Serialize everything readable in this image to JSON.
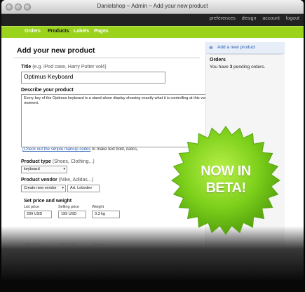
{
  "window": {
    "title": "Danielshop ~ Admin ~ Add your new product"
  },
  "toplinks": [
    "preferences",
    "design",
    "account",
    "logout"
  ],
  "nav": {
    "items": [
      "Orders",
      "Products",
      "Labels",
      "Pages"
    ],
    "active": "Products"
  },
  "page": {
    "heading": "Add your new product"
  },
  "form": {
    "title_label": "Title",
    "title_hint": "(e.g. iPod case, Harry Potter vol4)",
    "title_value": "Optimus Keyboard",
    "desc_label": "Describe your product",
    "desc_value": "Every key of the Optimus keyboard is a stand-alone display showing exactly what it is controlling at this very moment.",
    "markup_link": "(Check out the simple markup codes",
    "markup_rest": "to make text bold, italics,",
    "type_label": "Product type",
    "type_hint": "(Shoes, Clothing...)",
    "type_value": "keyboard",
    "vendor_label": "Product vendor",
    "vendor_hint": "(Nike, Adidas...)",
    "vendor_select": "Create new vendor",
    "vendor_value": "Art. Lebedev",
    "price_heading": "Set price and weight",
    "list_price_label": "List price",
    "list_price_value": "299 USD",
    "selling_price_label": "Selling price",
    "selling_price_value": "199 USD",
    "weight_label": "Weight",
    "weight_value": "0.3 kg"
  },
  "sidebar": {
    "add_link": "Add a new product",
    "orders_heading": "Orders",
    "orders_pre": "You have",
    "orders_count": "3",
    "orders_post": "pending orders."
  },
  "badge": {
    "line1": "NOW IN",
    "line2": "BETA!",
    "color": "#7ccf1a"
  },
  "reflection": {
    "list_price": "299 USD",
    "selling_price": "199 USD",
    "weight": "0.3 kg"
  }
}
